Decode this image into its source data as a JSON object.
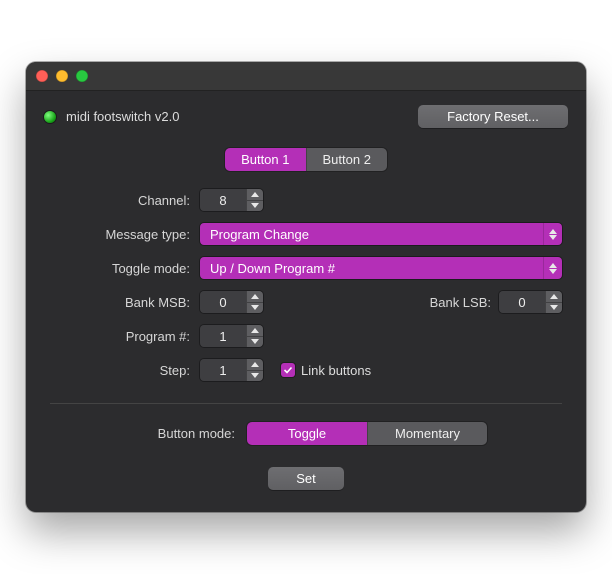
{
  "colors": {
    "accent": "#b42fb7"
  },
  "header": {
    "status": "green",
    "title": "midi footswitch v2.0",
    "factory_reset_label": "Factory Reset..."
  },
  "tabs": {
    "items": [
      "Button 1",
      "Button 2"
    ],
    "active_index": 0
  },
  "form": {
    "channel": {
      "label": "Channel:",
      "value": 8
    },
    "message_type": {
      "label": "Message type:",
      "value": "Program Change"
    },
    "toggle_mode": {
      "label": "Toggle mode:",
      "value": "Up / Down Program #"
    },
    "bank_msb": {
      "label": "Bank MSB:",
      "value": 0
    },
    "bank_lsb": {
      "label": "Bank LSB:",
      "value": 0
    },
    "program": {
      "label": "Program #:",
      "value": 1
    },
    "step": {
      "label": "Step:",
      "value": 1
    },
    "link_buttons": {
      "label": "Link buttons",
      "checked": true
    }
  },
  "button_mode": {
    "label": "Button mode:",
    "options": [
      "Toggle",
      "Momentary"
    ],
    "active_index": 0
  },
  "footer": {
    "set_label": "Set"
  }
}
